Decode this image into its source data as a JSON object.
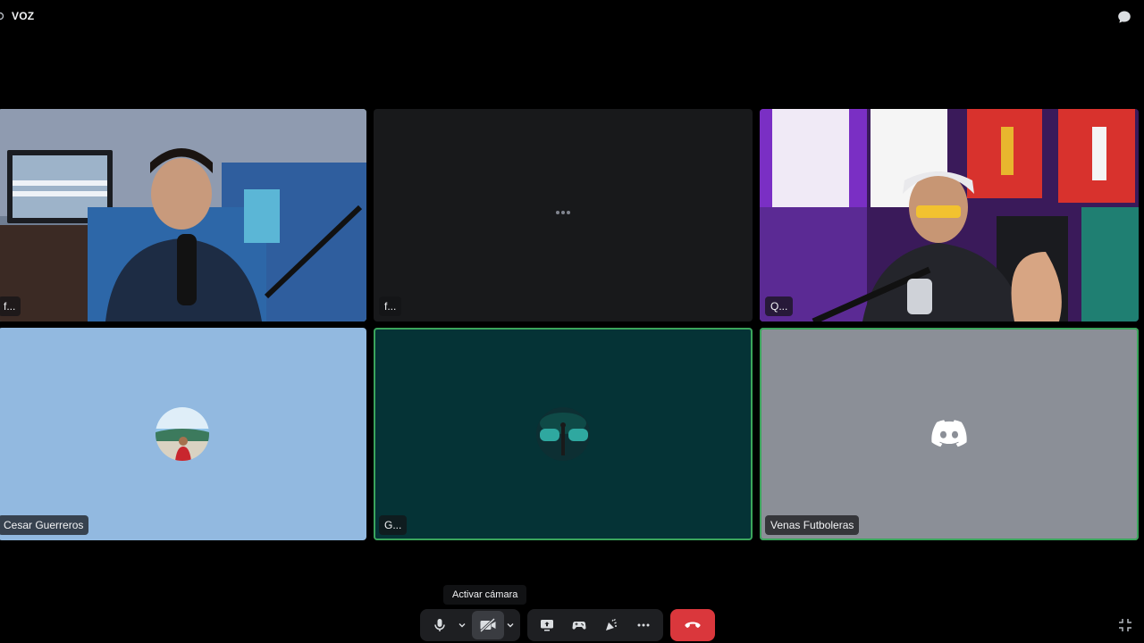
{
  "header": {
    "title": "VOZ",
    "voice_icon": "speaker-icon",
    "chat_icon": "chat-bubble-icon"
  },
  "tiles": [
    {
      "name": "f...",
      "kind": "video",
      "speaking": true
    },
    {
      "name": "f...",
      "kind": "loading",
      "speaking": false
    },
    {
      "name": "Q...",
      "kind": "video",
      "speaking": false
    },
    {
      "name": "Cesar Guerreros",
      "kind": "avatar",
      "speaking": false,
      "bg": "#92b9e0"
    },
    {
      "name": "G...",
      "kind": "avatar",
      "speaking": true,
      "bg": "#053336"
    },
    {
      "name": "Venas Futboleras",
      "kind": "discord-logo",
      "speaking": true,
      "bg": "#8b8f97"
    }
  ],
  "tooltip": {
    "text": "Activar cámara"
  },
  "controls": {
    "icons": [
      "microphone-icon",
      "chevron-down-icon",
      "camera-off-icon",
      "chevron-down-icon",
      "screen-share-icon",
      "activities-icon",
      "soundboard-icon",
      "more-icon",
      "hang-up-icon",
      "fullscreen-exit-icon"
    ]
  },
  "colors": {
    "speaking_border": "#3ba55c",
    "hangup": "#da373c",
    "control_bg": "#1e1f22"
  }
}
